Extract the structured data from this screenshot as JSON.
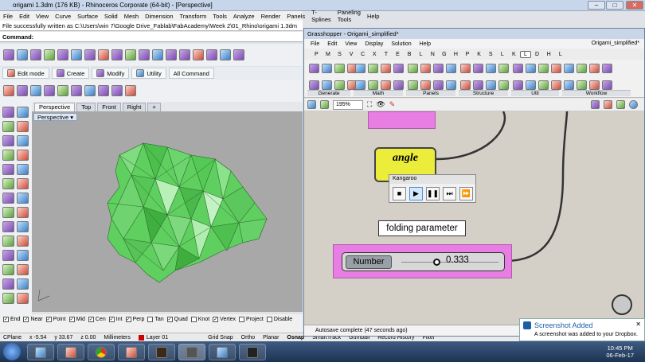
{
  "rhino": {
    "title": "origami 1.3dm (176 KB) - Rhinoceros Corporate (64-bit) - [Perspective]",
    "menu": [
      "File",
      "Edit",
      "View",
      "Curve",
      "Surface",
      "Solid",
      "Mesh",
      "Dimension",
      "Transform",
      "Tools",
      "Analyze",
      "Render",
      "Panels",
      "T-Splines",
      "Paneling Tools",
      "Help"
    ],
    "history": "File successfully written as C:\\Users\\win 7\\Google Drive_Fablab\\FabAcademy\\Week 2\\01_Rhino\\origami 1.3dm",
    "command_label": "Command:",
    "tabs": [
      "Edit mode",
      "Create",
      "Modify",
      "Utility",
      "All Command"
    ],
    "viewport_tabs": [
      "Perspective",
      "Top",
      "Front",
      "Right",
      "+"
    ],
    "viewport_label": "Perspective",
    "osnaps": [
      "End",
      "Near",
      "Point",
      "Mid",
      "Cen",
      "Int",
      "Perp",
      "Tan",
      "Quad",
      "Knot",
      "Vertex",
      "Project",
      "Disable"
    ],
    "osnaps_checked": [
      true,
      true,
      true,
      true,
      true,
      true,
      true,
      false,
      true,
      false,
      true,
      false,
      false
    ],
    "status": {
      "cplane": "CPlane",
      "x": "x -5.54",
      "y": "y 33.67",
      "z": "z 0.00",
      "units": "Millimeters",
      "layer": "Layer 01",
      "modes": [
        "Grid Snap",
        "Ortho",
        "Planar",
        "Osnap",
        "SmartTrack",
        "Gumball",
        "Record History",
        "Filter"
      ]
    }
  },
  "gh": {
    "title": "Grasshopper - Origami_simplified*",
    "menu": [
      "File",
      "Edit",
      "View",
      "Display",
      "Solution",
      "Help"
    ],
    "doc": "Origami_simplified*",
    "categories": [
      "P",
      "M",
      "S",
      "V",
      "C",
      "X",
      "T",
      "E",
      "B",
      "L",
      "N",
      "G",
      "H",
      "P",
      "K",
      "S",
      "L",
      "K",
      "L",
      "D",
      "H",
      "L"
    ],
    "selected_category_index": 18,
    "panels": [
      "Generate",
      "Math",
      "Panels",
      "Structure",
      "Util",
      "Workflow"
    ],
    "zoom": "195%",
    "angle_label": "angle",
    "kangaroo_title": "Kangaroo",
    "kangaroo_buttons": [
      "■",
      "▶",
      "❚❚",
      "⏭",
      "⏩"
    ],
    "tooltip": "folding parameter",
    "slider_label": "Number",
    "slider_value": "0.333",
    "status": "Autosave complete (47 seconds ago)"
  },
  "notification": {
    "title": "Screenshot Added",
    "body": "A screenshot was added to your Dropbox."
  },
  "clock": {
    "time": "10:45 PM",
    "date": "06-Feb-17"
  }
}
